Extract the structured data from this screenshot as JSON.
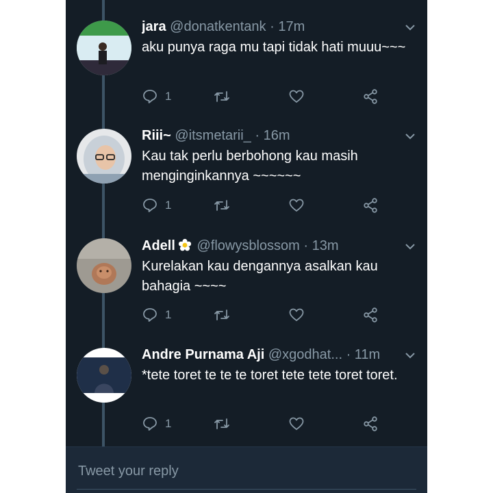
{
  "tweets": [
    {
      "name": "jara",
      "handle": "@donatkentank",
      "time": "· 17m",
      "text": "aku punya raga mu tapi tidak hati muuu~~~",
      "reply_count": "1"
    },
    {
      "name": "Riii~",
      "handle": "@itsmetarii_",
      "time": "· 16m",
      "text": "Kau tak perlu berbohong kau masih menginginkannya ~~~~~~",
      "reply_count": "1"
    },
    {
      "name": "Adell",
      "handle": "@flowysblossom",
      "time": "· 13m",
      "text": "Kurelakan kau dengannya asalkan kau bahagia ~~~~",
      "reply_count": "1"
    },
    {
      "name": "Andre Purnama Aji",
      "handle": "@xgodhat...",
      "time": "· 11m",
      "text": "*tete toret te te te toret tete tete toret toret.",
      "reply_count": "1"
    }
  ],
  "reply_bar": {
    "placeholder": "Tweet your reply"
  },
  "icons": {
    "reply": "reply-icon",
    "retweet": "retweet-icon",
    "like": "heart-icon",
    "share": "share-icon",
    "caret": "chevron-down-icon",
    "flower": "flower-emoji-icon"
  },
  "colors": {
    "background": "#141d26",
    "secondary_text": "#8899a6",
    "primary_text": "#ffffff",
    "thread_line": "#3d5466"
  }
}
